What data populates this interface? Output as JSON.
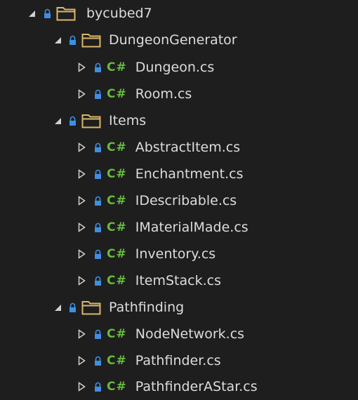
{
  "tree": {
    "root": {
      "label": "bycubed7",
      "icon": "folder-icon",
      "expanded": true,
      "locked": true
    },
    "folders": [
      {
        "label": "DungeonGenerator",
        "expanded": true,
        "files": [
          {
            "label": "Dungeon.cs",
            "type": "C#"
          },
          {
            "label": "Room.cs",
            "type": "C#"
          }
        ]
      },
      {
        "label": "Items",
        "expanded": true,
        "files": [
          {
            "label": "AbstractItem.cs",
            "type": "C#"
          },
          {
            "label": "Enchantment.cs",
            "type": "C#"
          },
          {
            "label": "IDescribable.cs",
            "type": "C#"
          },
          {
            "label": "IMaterialMade.cs",
            "type": "C#"
          },
          {
            "label": "Inventory.cs",
            "type": "C#"
          },
          {
            "label": "ItemStack.cs",
            "type": "C#"
          }
        ]
      },
      {
        "label": "Pathfinding",
        "expanded": true,
        "files": [
          {
            "label": "NodeNetwork.cs",
            "type": "C#"
          },
          {
            "label": "Pathfinder.cs",
            "type": "C#"
          },
          {
            "label": "PathfinderAStar.cs",
            "type": "C#"
          }
        ]
      }
    ]
  },
  "colors": {
    "background": "#1e1e1e",
    "text": "#dcdcdc",
    "caret": "#d0d0d0",
    "lock": "#3d8fe6",
    "folder_stroke": "#d9b86a",
    "csharp": "#68b93e"
  }
}
